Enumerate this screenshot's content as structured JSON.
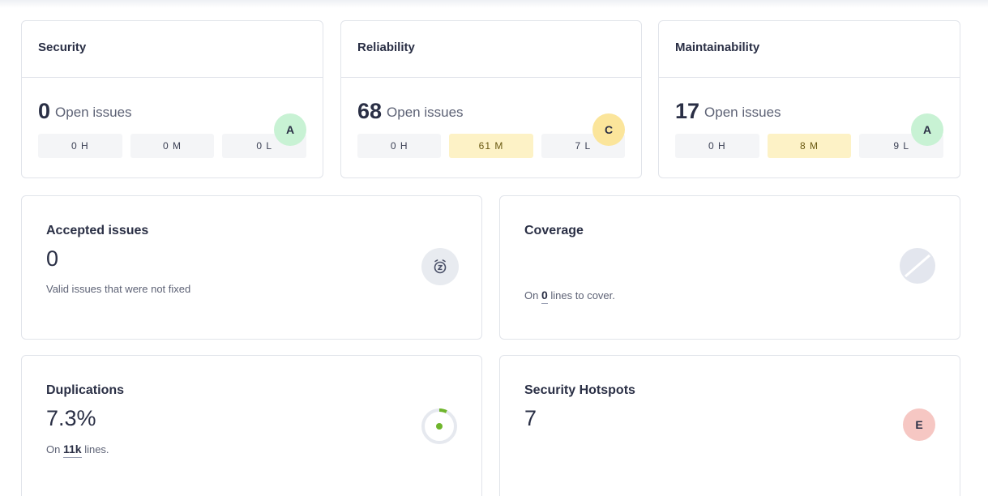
{
  "ratings": [
    {
      "title": "Security",
      "count": "0",
      "label": "Open issues",
      "grade": "A",
      "grade_color": "#c8f2d4",
      "sev": [
        {
          "text": "0 H"
        },
        {
          "text": "0 M"
        },
        {
          "text": "0 L"
        }
      ]
    },
    {
      "title": "Reliability",
      "count": "68",
      "label": "Open issues",
      "grade": "C",
      "grade_color": "#fbe59b",
      "sev": [
        {
          "text": "0 H"
        },
        {
          "text": "61 M"
        },
        {
          "text": "7 L"
        }
      ]
    },
    {
      "title": "Maintainability",
      "count": "17",
      "label": "Open issues",
      "grade": "A",
      "grade_color": "#c8f2d4",
      "sev": [
        {
          "text": "0 H"
        },
        {
          "text": "8 M"
        },
        {
          "text": "9 L"
        }
      ]
    }
  ],
  "accepted": {
    "title": "Accepted issues",
    "value": "0",
    "sub": "Valid issues that were not fixed",
    "icon": "alarm-z-icon"
  },
  "coverage": {
    "title": "Coverage",
    "sub_prefix": "On",
    "sub_value": "0",
    "sub_suffix": "lines to cover.",
    "icon": "coverage-empty-icon"
  },
  "duplications": {
    "title": "Duplications",
    "value": "7.3%",
    "sub_prefix": "On",
    "sub_value": "11k",
    "sub_suffix": "lines.",
    "icon": "duplication-donut-icon",
    "fraction": 0.073
  },
  "hotspots": {
    "title": "Security Hotspots",
    "value": "7",
    "grade": "E",
    "grade_color": "#f6c7c3"
  }
}
